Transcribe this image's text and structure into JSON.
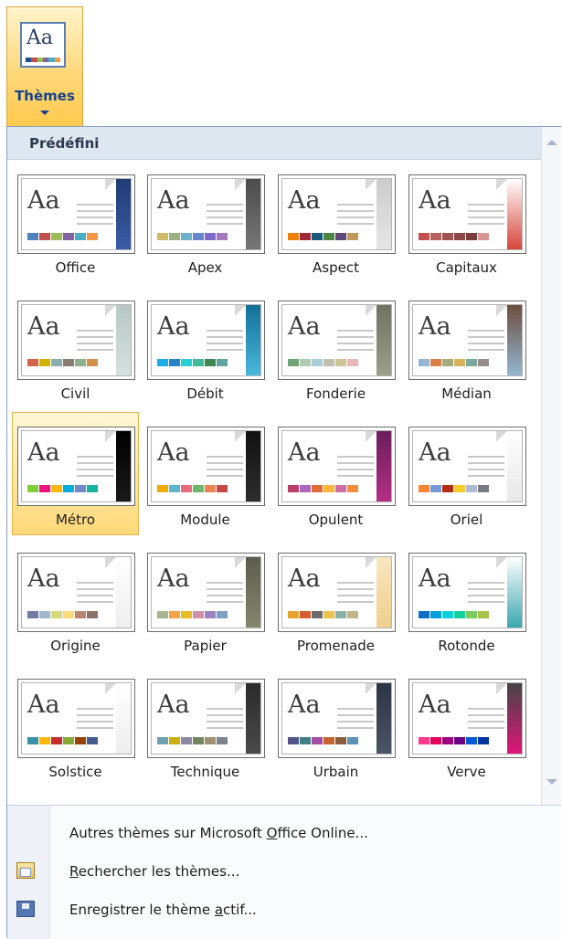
{
  "ribbon": {
    "button_label": "Thèmes",
    "icon_text": "Aa",
    "icon_strip_colors": [
      "#1f4e8c",
      "#c0504d",
      "#9bbb59",
      "#8064a2",
      "#4bacc6",
      "#f79646"
    ]
  },
  "gallery": {
    "section_header": "Prédéfini",
    "selected": "Métro",
    "themes": [
      {
        "name": "Office",
        "aa": "Aa",
        "bar": "#1f3b73",
        "bar2": "#3a5da8",
        "swatches": [
          "#4f81bd",
          "#c0504d",
          "#9bbb59",
          "#8064a2",
          "#4bacc6",
          "#f79646"
        ]
      },
      {
        "name": "Apex",
        "aa": "Aa",
        "bar": "#4c4c4c",
        "bar2": "#777777",
        "swatches": [
          "#ceb966",
          "#9cb084",
          "#6bb1c9",
          "#6585cf",
          "#7e6bc9",
          "#a379bb"
        ]
      },
      {
        "name": "Aspect",
        "aa": "Aa",
        "bar": "#cccccc",
        "bar2": "#e6e6e6",
        "swatches": [
          "#f07f09",
          "#9f2936",
          "#1b587c",
          "#4e8542",
          "#604878",
          "#c19859"
        ]
      },
      {
        "name": "Capitaux",
        "aa": "Aa",
        "bar": "#ffffff",
        "bar2": "#d6453a",
        "swatches": [
          "#c0504d",
          "#b86060",
          "#a05252",
          "#8c4646",
          "#7a3c3c",
          "#d99694"
        ]
      },
      {
        "name": "Civil",
        "aa": "Aa",
        "bar": "#b7c8c6",
        "bar2": "#d6e0df",
        "swatches": [
          "#d16349",
          "#ccb400",
          "#8cadae",
          "#8c7b70",
          "#8fb08c",
          "#d19049"
        ]
      },
      {
        "name": "Débit",
        "aa": "Aa",
        "bar": "#136f96",
        "bar2": "#4ab7dd",
        "swatches": [
          "#1cade4",
          "#2683c6",
          "#27ced7",
          "#42ba97",
          "#3e8853",
          "#62a39f"
        ]
      },
      {
        "name": "Fonderie",
        "aa": "Aa",
        "bar": "#6f7261",
        "bar2": "#9aa08c",
        "swatches": [
          "#72a376",
          "#b0ccb0",
          "#a8cdd7",
          "#c0beaf",
          "#cec597",
          "#e8b7b7"
        ]
      },
      {
        "name": "Médian",
        "aa": "Aa",
        "bar": "#6b4d3d",
        "bar2": "#94b6d2",
        "swatches": [
          "#94b6d2",
          "#dd8047",
          "#a5ab81",
          "#d8b25c",
          "#7ba79d",
          "#968c8c"
        ]
      },
      {
        "name": "Métro",
        "aa": "Aa",
        "bar": "#000000",
        "bar2": "#1a1a1a",
        "swatches": [
          "#7fd13b",
          "#ea157a",
          "#feb80a",
          "#00addc",
          "#738ac8",
          "#1ab39f"
        ]
      },
      {
        "name": "Module",
        "aa": "Aa",
        "bar": "#111111",
        "bar2": "#2d2d2d",
        "swatches": [
          "#f0ad00",
          "#60b5cc",
          "#e66c7d",
          "#6bb76d",
          "#e88651",
          "#c64847"
        ]
      },
      {
        "name": "Opulent",
        "aa": "Aa",
        "bar": "#6a1e5a",
        "bar2": "#b42e85",
        "swatches": [
          "#b83d68",
          "#ac66bb",
          "#de6c36",
          "#f9b639",
          "#cf6da4",
          "#fa8d3d"
        ]
      },
      {
        "name": "Oriel",
        "aa": "Aa",
        "bar": "#ffffff",
        "bar2": "#e8e8e8",
        "swatches": [
          "#fe8637",
          "#7598d9",
          "#b32c16",
          "#f5cd2d",
          "#aebad5",
          "#777c84"
        ]
      },
      {
        "name": "Origine",
        "aa": "Aa",
        "bar": "#ffffff",
        "bar2": "#eeeeee",
        "swatches": [
          "#727ca3",
          "#9fb8cd",
          "#d2da7a",
          "#fada7a",
          "#b88472",
          "#8e736a"
        ]
      },
      {
        "name": "Papier",
        "aa": "Aa",
        "bar": "#5c5c4c",
        "bar2": "#86866e",
        "swatches": [
          "#a5b592",
          "#f3a447",
          "#e7bc29",
          "#d092a7",
          "#9c85c0",
          "#809ec2"
        ]
      },
      {
        "name": "Promenade",
        "aa": "Aa",
        "bar": "#f8e7c0",
        "bar2": "#efcf8d",
        "swatches": [
          "#e5a430",
          "#d35f2e",
          "#6c6c6c",
          "#ebc44b",
          "#8ab2a9",
          "#c1b58a"
        ]
      },
      {
        "name": "Rotonde",
        "aa": "Aa",
        "bar": "#ffffff",
        "bar2": "#3aa7b0",
        "swatches": [
          "#0f6fc6",
          "#009dd9",
          "#0bd0d9",
          "#10cf9b",
          "#7cca62",
          "#a5c249"
        ]
      },
      {
        "name": "Solstice",
        "aa": "Aa",
        "bar": "#ffffff",
        "bar2": "#eeeeee",
        "swatches": [
          "#3891a7",
          "#feb80a",
          "#c32d2e",
          "#84aa33",
          "#964305",
          "#475a8d"
        ]
      },
      {
        "name": "Technique",
        "aa": "Aa",
        "bar": "#2b2b2b",
        "bar2": "#4a4a4a",
        "swatches": [
          "#6ea0b0",
          "#ccaf0a",
          "#8d89a4",
          "#748560",
          "#9e9273",
          "#7e848d"
        ]
      },
      {
        "name": "Urbain",
        "aa": "Aa",
        "bar": "#2c3444",
        "bar2": "#4a5567",
        "swatches": [
          "#53548a",
          "#438086",
          "#a04da3",
          "#c4652d",
          "#8b5d3d",
          "#5c92b5"
        ]
      },
      {
        "name": "Verve",
        "aa": "Aa",
        "bar": "#444444",
        "bar2": "#e0147a",
        "swatches": [
          "#ff388c",
          "#e40059",
          "#9c007f",
          "#68007f",
          "#005bd3",
          "#00349e"
        ]
      }
    ]
  },
  "menu": {
    "item1": {
      "prefix": "Autres thèmes sur Microsoft ",
      "mnemonic": "O",
      "suffix": "ffice Online..."
    },
    "item2": {
      "prefix": "",
      "mnemonic": "R",
      "suffix": "echercher les thèmes..."
    },
    "item3": {
      "prefix": "Enregistrer le thème ",
      "mnemonic": "a",
      "suffix": "ctif..."
    }
  }
}
